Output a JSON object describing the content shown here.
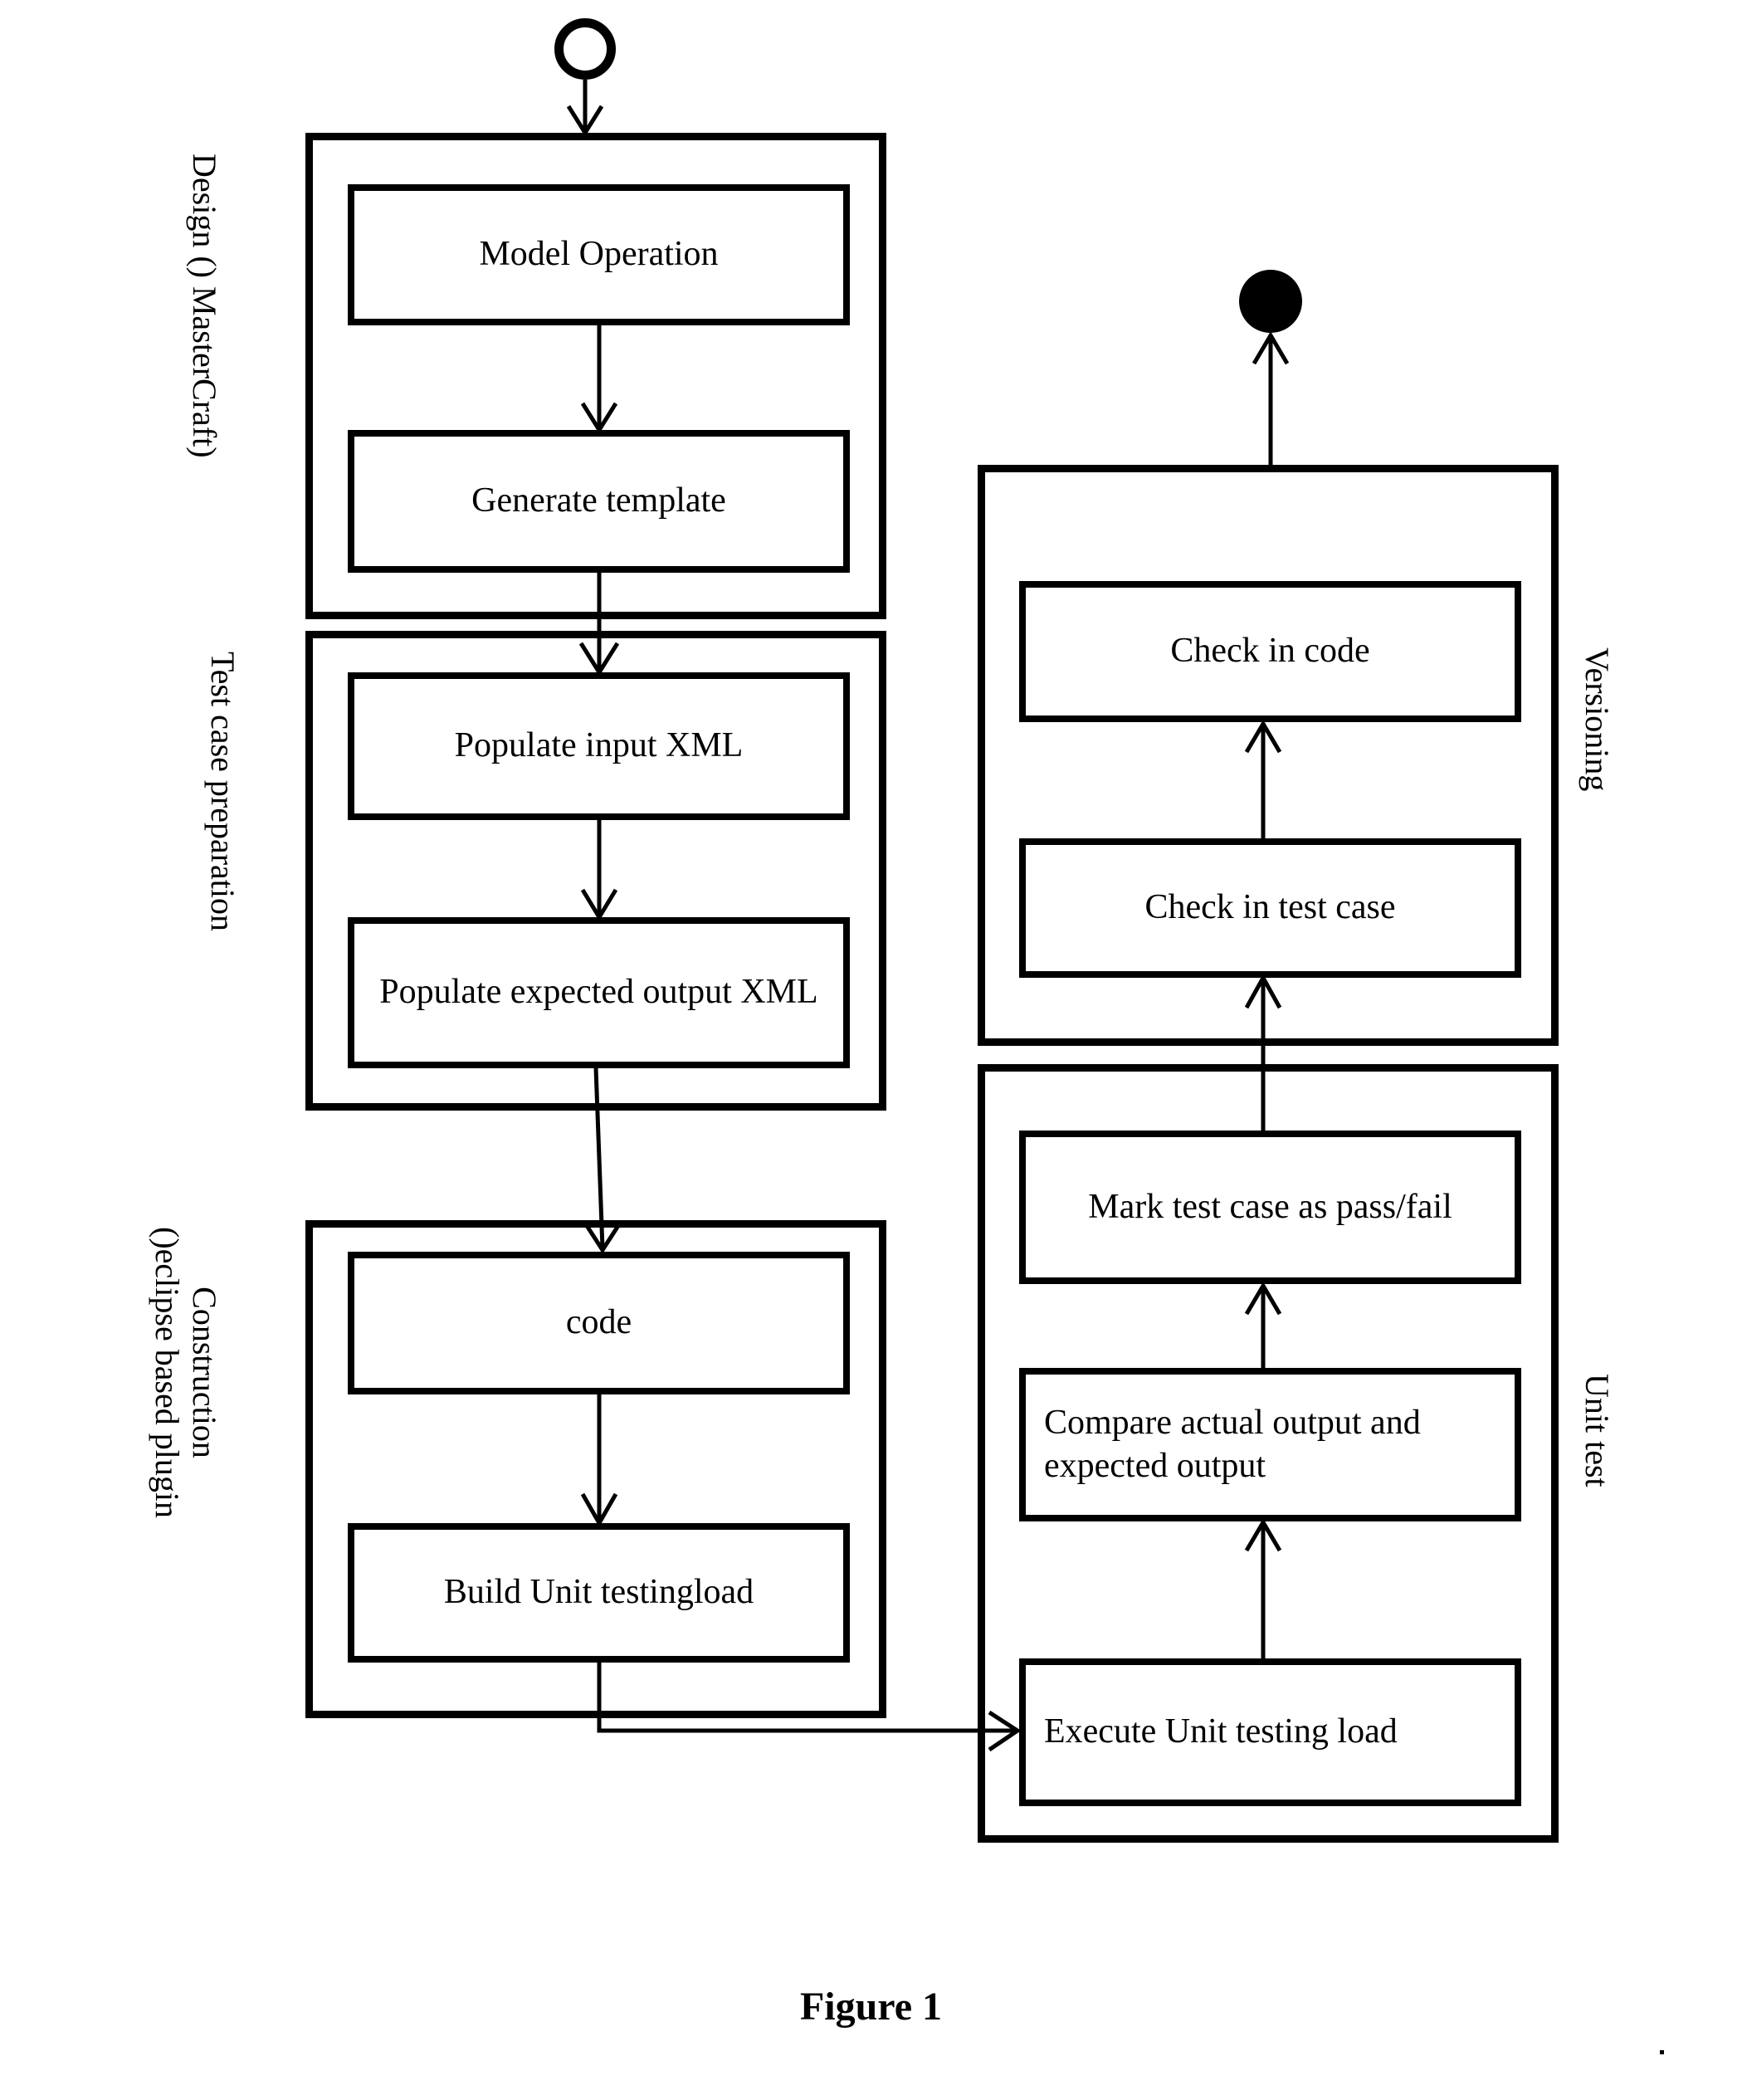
{
  "figure": {
    "caption": "Figure 1",
    "type": "uml-activity-diagram"
  },
  "lanes": [
    {
      "id": "design",
      "label": "Design () MasterCraft)",
      "label_lines": [
        "Design () MasterCraft)"
      ]
    },
    {
      "id": "test-case-preparation",
      "label": "Test case preparation",
      "label_lines": [
        "Test case preparation"
      ]
    },
    {
      "id": "construction",
      "label": "Construction ()eclipse based plugin",
      "label_lines": [
        "Construction",
        "()eclipse based plugin"
      ]
    },
    {
      "id": "versioning",
      "label": "Versioning",
      "label_lines": [
        "Versioning"
      ]
    },
    {
      "id": "unit-test",
      "label": "Unit test",
      "label_lines": [
        "Unit test"
      ]
    }
  ],
  "nodes": {
    "start": {
      "name": "start-node",
      "label": ""
    },
    "end": {
      "name": "end-node",
      "label": ""
    },
    "model_operation": {
      "label": "Model Operation"
    },
    "generate_template": {
      "label": "Generate  template"
    },
    "populate_input_xml": {
      "label": "Populate input XML"
    },
    "populate_expected_output_xml": {
      "label": "Populate expected output XML"
    },
    "code": {
      "label": "code"
    },
    "build_unit_testingload": {
      "label": "Build Unit testingload"
    },
    "check_in_code": {
      "label": "Check in code"
    },
    "check_in_test_case": {
      "label": "Check in test case"
    },
    "mark_test_case": {
      "label": "Mark test case as pass/fail"
    },
    "compare_outputs": {
      "label": "Compare actual output and expected output"
    },
    "execute_unit_testing_load": {
      "label": "Execute Unit testing load"
    }
  },
  "flow": [
    {
      "from": "start",
      "to": "model_operation"
    },
    {
      "from": "model_operation",
      "to": "generate_template"
    },
    {
      "from": "generate_template",
      "to": "populate_input_xml"
    },
    {
      "from": "populate_input_xml",
      "to": "populate_expected_output_xml"
    },
    {
      "from": "populate_expected_output_xml",
      "to": "code"
    },
    {
      "from": "code",
      "to": "build_unit_testingload"
    },
    {
      "from": "build_unit_testingload",
      "to": "execute_unit_testing_load"
    },
    {
      "from": "execute_unit_testing_load",
      "to": "compare_outputs"
    },
    {
      "from": "compare_outputs",
      "to": "mark_test_case"
    },
    {
      "from": "mark_test_case",
      "to": "check_in_test_case"
    },
    {
      "from": "check_in_test_case",
      "to": "check_in_code"
    },
    {
      "from": "check_in_code",
      "to": "end"
    }
  ],
  "colors": {
    "stroke": "#000000",
    "background": "#ffffff",
    "fill": "#ffffff"
  }
}
